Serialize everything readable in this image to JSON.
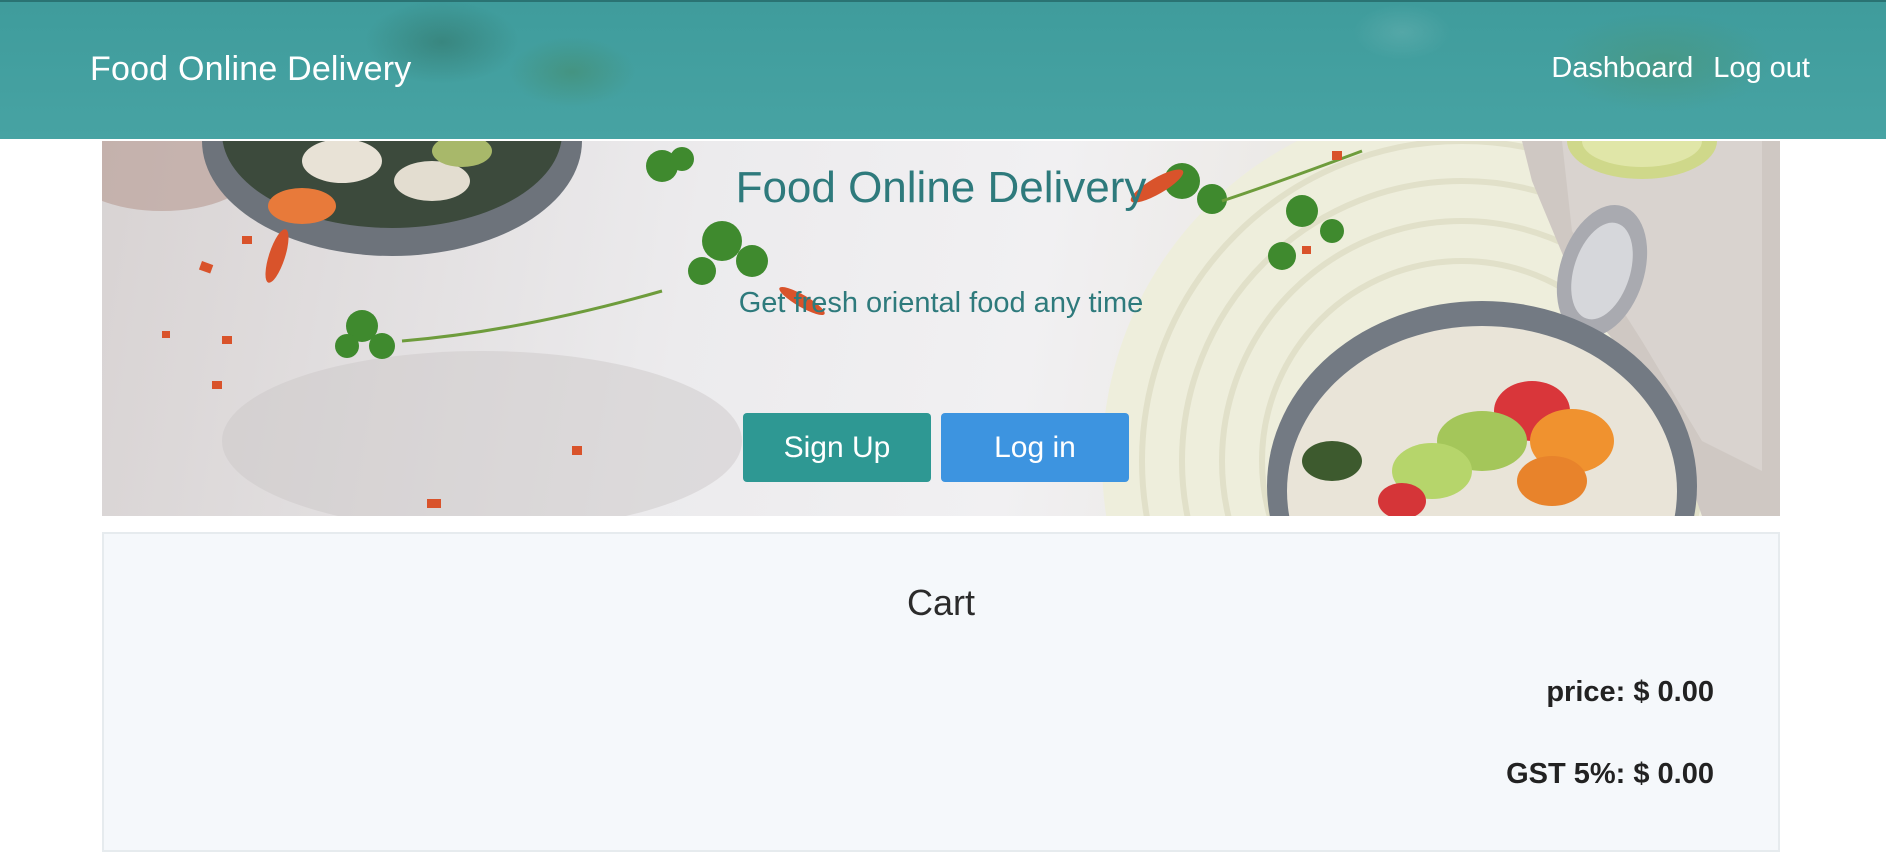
{
  "navbar": {
    "brand": "Food Online Delivery",
    "links": [
      {
        "label": "Dashboard"
      },
      {
        "label": "Log out"
      }
    ]
  },
  "hero": {
    "title": "Food Online Delivery",
    "subtitle": "Get fresh oriental food any time",
    "buttons": {
      "signup": "Sign Up",
      "login": "Log in"
    }
  },
  "cart": {
    "title": "Cart",
    "price_line": "price: $ 0.00",
    "gst_line": "GST 5%: $ 0.00"
  },
  "colors": {
    "navbar": "#42a0a0",
    "accent_text": "#2e7a7c",
    "signup_button": "#2e9893",
    "login_button": "#3d94e0",
    "cart_background": "#f5f8fb"
  }
}
